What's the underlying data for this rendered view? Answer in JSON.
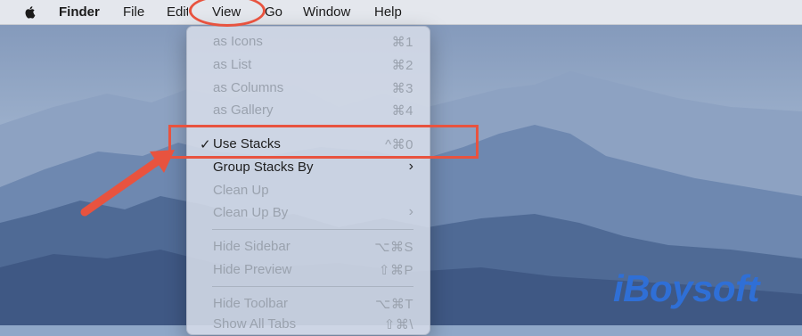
{
  "menubar": {
    "app_name": "Finder",
    "items": [
      "File",
      "Edit",
      "View",
      "Go",
      "Window",
      "Help"
    ]
  },
  "view_menu": {
    "items": [
      {
        "label": "as Icons",
        "shortcut": "⌘1",
        "enabled": false
      },
      {
        "label": "as List",
        "shortcut": "⌘2",
        "enabled": false
      },
      {
        "label": "as Columns",
        "shortcut": "⌘3",
        "enabled": false
      },
      {
        "label": "as Gallery",
        "shortcut": "⌘4",
        "enabled": false
      },
      {
        "label": "Use Stacks",
        "shortcut": "^⌘0",
        "enabled": true,
        "checked": true
      },
      {
        "label": "Group Stacks By",
        "submenu": true,
        "enabled": true
      },
      {
        "label": "Clean Up",
        "enabled": false
      },
      {
        "label": "Clean Up By",
        "submenu": true,
        "enabled": false
      },
      {
        "label": "Hide Sidebar",
        "shortcut": "⌥⌘S",
        "enabled": false
      },
      {
        "label": "Hide Preview",
        "shortcut": "⇧⌘P",
        "enabled": false
      },
      {
        "label": "Hide Toolbar",
        "shortcut": "⌥⌘T",
        "enabled": false
      },
      {
        "label": "Show All Tabs",
        "shortcut": "⇧⌘\\",
        "enabled": false
      }
    ],
    "check_mark": "✓",
    "submenu_arrow": "›"
  },
  "watermark": "iBoysoft",
  "colors": {
    "annotation": "#e8533f",
    "logo": "#2f6fd6",
    "sky": "#8fa7c8"
  }
}
